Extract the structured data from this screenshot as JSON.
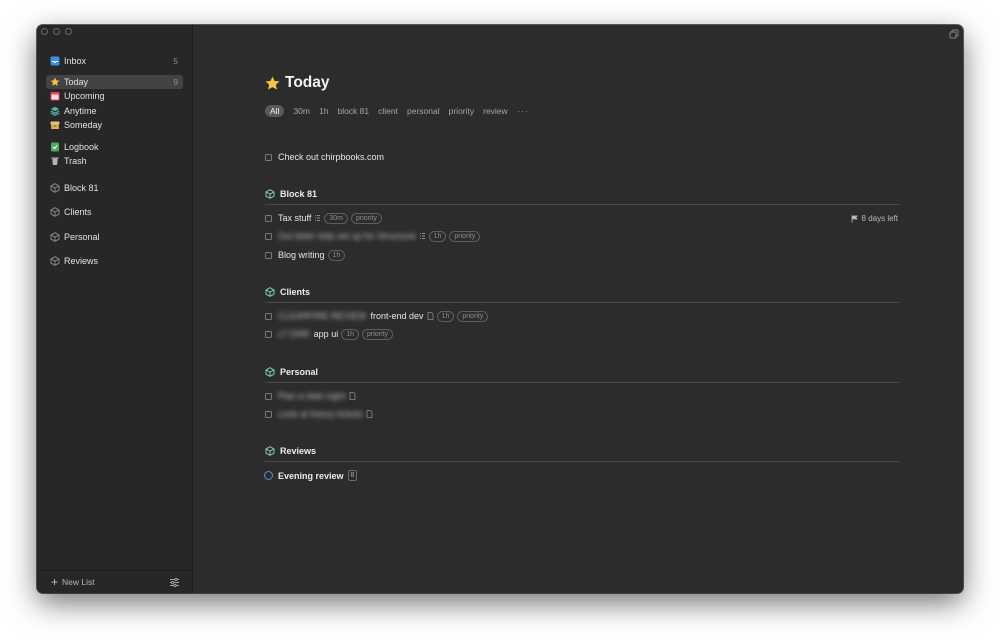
{
  "sidebar": {
    "items": [
      {
        "label": "Inbox",
        "count": "5",
        "icon": "inbox-icon"
      },
      {
        "label": "Today",
        "count": "9",
        "icon": "star-icon"
      },
      {
        "label": "Upcoming",
        "icon": "calendar-icon"
      },
      {
        "label": "Anytime",
        "icon": "stack-icon"
      },
      {
        "label": "Someday",
        "icon": "archive-box-icon"
      },
      {
        "label": "Logbook",
        "icon": "logbook-icon"
      },
      {
        "label": "Trash",
        "icon": "trash-icon"
      }
    ],
    "areas": [
      {
        "label": "Block 81",
        "icon": "area-cube-icon"
      },
      {
        "label": "Clients",
        "icon": "area-cube-icon"
      },
      {
        "label": "Personal",
        "icon": "area-cube-icon"
      },
      {
        "label": "Reviews",
        "icon": "area-cube-icon"
      }
    ],
    "new_list_label": "New List"
  },
  "main": {
    "title": "Today",
    "filters": [
      "All",
      "30m",
      "1h",
      "block 81",
      "client",
      "personal",
      "priority",
      "review"
    ],
    "more_label": "···",
    "loose_task": "Check out chirpbooks.com",
    "sections": {
      "block81": {
        "title": "Block 81",
        "deadline": "8 days left",
        "tasks": [
          {
            "text": "Tax stuff",
            "tags": [
              "30m",
              "priority"
            ]
          },
          {
            "text": "Out letter help set up for Structural",
            "tags": [
              "1h",
              "priority"
            ]
          },
          {
            "text": "Blog writing",
            "tags": [
              "1h"
            ]
          }
        ]
      },
      "clients": {
        "title": "Clients",
        "tasks": [
          {
            "blurred": "CLEARFIRE REVIEW",
            "text": "front-end dev",
            "tags": [
              "1h",
              "priority"
            ]
          },
          {
            "blurred": "LT DNR",
            "text": "app ui",
            "tags": [
              "1h",
              "priority"
            ]
          }
        ]
      },
      "personal": {
        "title": "Personal",
        "tasks": [
          {
            "text": "Plan a date night"
          },
          {
            "text": "Look at theory tickets"
          }
        ]
      },
      "reviews": {
        "title": "Reviews",
        "project": "Evening review",
        "project_count": "8"
      }
    }
  },
  "colors": {
    "window_bg": "#2c2c2d",
    "sidebar_bg": "#272728",
    "area_icon": "#7fc9b4",
    "evening_circle": "#5a8fd1",
    "star": "#f5c542"
  }
}
